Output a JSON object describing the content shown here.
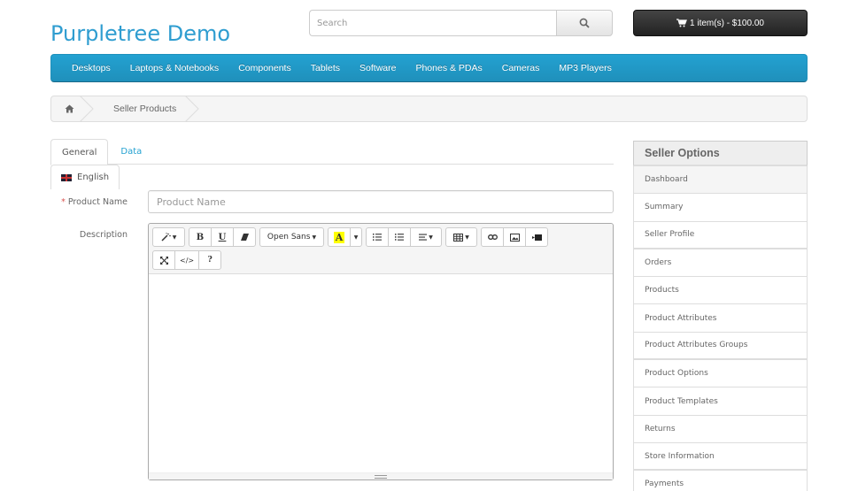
{
  "header": {
    "logo": "Purpletree Demo",
    "search_placeholder": "Search",
    "cart_label": "1 item(s) - $100.00"
  },
  "menu": {
    "items": [
      "Desktops",
      "Laptops & Notebooks",
      "Components",
      "Tablets",
      "Software",
      "Phones & PDAs",
      "Cameras",
      "MP3 Players"
    ]
  },
  "breadcrumb": {
    "home_icon": "home-icon",
    "current": "Seller Products"
  },
  "tabs": {
    "general": "General",
    "data": "Data"
  },
  "language_tab": {
    "label": "English",
    "flag": "uk-flag"
  },
  "form": {
    "required_marker": "*",
    "product_name_label": "Product Name",
    "product_name_value": "",
    "product_name_placeholder": "Product Name",
    "description_label": "Description"
  },
  "editor": {
    "style_icon": "magic-wand-icon",
    "bold": "B",
    "underline": "U",
    "eraser_icon": "eraser-icon",
    "font_family": "Open Sans",
    "color_letter": "A",
    "highlight_color": "#ffff00",
    "ul_icon": "unordered-list-icon",
    "ol_icon": "ordered-list-icon",
    "align_icon": "align-icon",
    "table_icon": "table-icon",
    "link_icon": "link-icon",
    "picture_icon": "picture-icon",
    "video_icon": "video-icon",
    "fullscreen_icon": "fullscreen-icon",
    "code": "</>",
    "help": "?"
  },
  "sidebar": {
    "title": "Seller Options",
    "items": [
      "Dashboard",
      "Summary",
      "Seller Profile",
      "Orders",
      "Products",
      "Product Attributes",
      "Product Attributes Groups",
      "Product Options",
      "Product Templates",
      "Returns",
      "Store Information",
      "Payments"
    ]
  },
  "colors": {
    "brand": "#2f9dd0",
    "menu_bg": "#229ac8",
    "cart_bg": "#303030"
  }
}
